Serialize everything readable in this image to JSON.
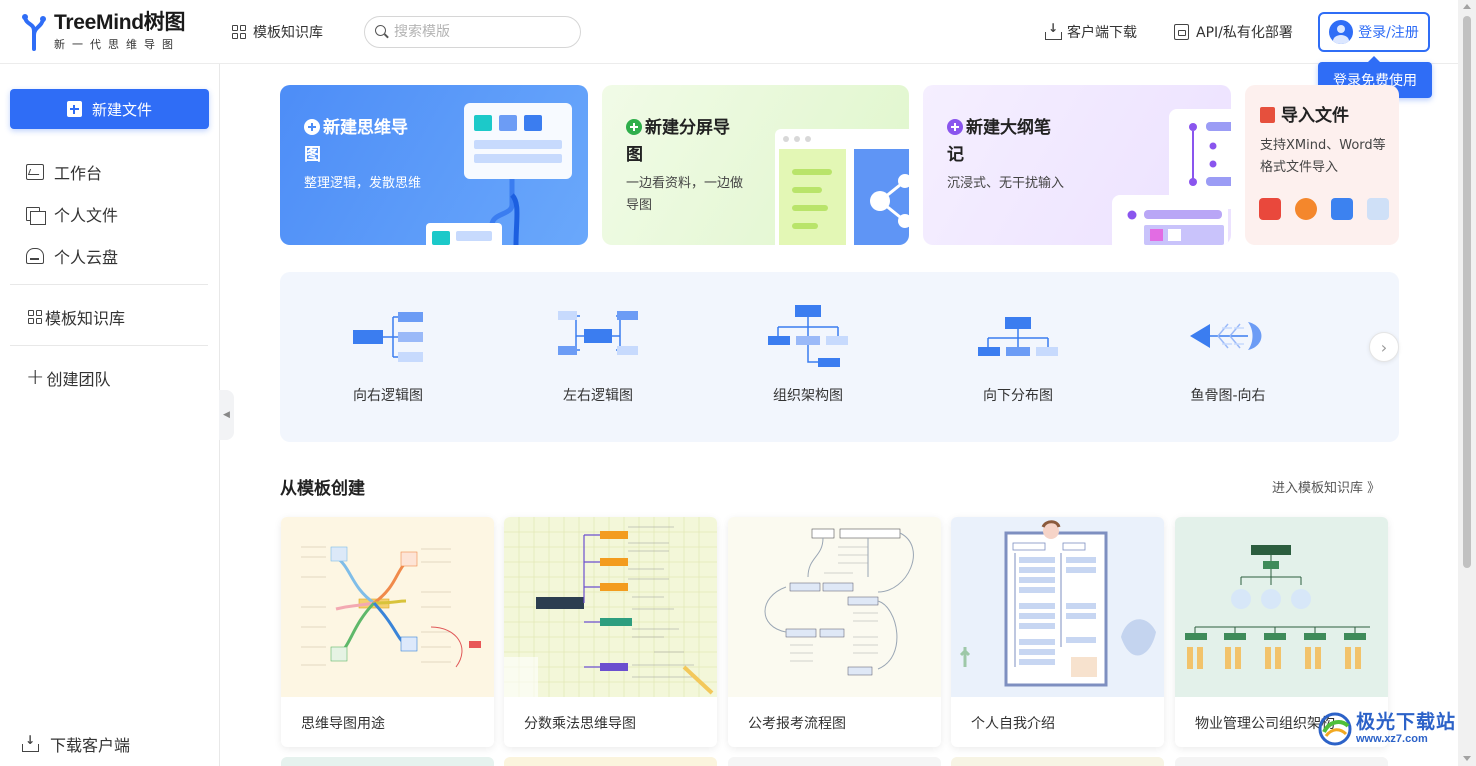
{
  "header": {
    "logo_title": "TreeMind树图",
    "logo_subtitle": "新一代思维导图",
    "nav_templates": "模板知识库",
    "search_placeholder": "搜索模版",
    "client_download": "客户端下载",
    "api_deploy": "API/私有化部署",
    "login": "登录/注册",
    "login_tooltip": "登录免费使用"
  },
  "sidebar": {
    "new_file": "新建文件",
    "items": [
      {
        "label": "工作台",
        "icon": "workbench-icon"
      },
      {
        "label": "个人文件",
        "icon": "folder-icon"
      },
      {
        "label": "个人云盘",
        "icon": "cloud-drive-icon"
      }
    ],
    "template_library": "模板知识库",
    "create_team": "创建团队",
    "download_client": "下载客户端"
  },
  "quick_cards": [
    {
      "title": "新建思维导图",
      "desc": "整理逻辑，发散思维",
      "accent": "#4d8df7"
    },
    {
      "title": "新建分屏导图",
      "desc": "一边看资料，一边做导图",
      "accent": "#2fae4b"
    },
    {
      "title": "新建大纲笔记",
      "desc": "沉浸式、无干扰输入",
      "accent": "#8a55ee"
    },
    {
      "title": "导入文件",
      "desc": "支持XMind、Word等格式文件导入",
      "accent": "#e6503d"
    }
  ],
  "structures": [
    {
      "label": "向右逻辑图",
      "icon": "right-logic-icon"
    },
    {
      "label": "左右逻辑图",
      "icon": "left-right-logic-icon"
    },
    {
      "label": "组织架构图",
      "icon": "org-chart-icon"
    },
    {
      "label": "向下分布图",
      "icon": "down-tree-icon"
    },
    {
      "label": "鱼骨图-向右",
      "icon": "fishbone-icon"
    }
  ],
  "templates_section": {
    "title": "从模板创建",
    "more": "进入模板知识库 》",
    "items": [
      {
        "label": "思维导图用途"
      },
      {
        "label": "分数乘法思维导图"
      },
      {
        "label": "公考报考流程图"
      },
      {
        "label": "个人自我介绍"
      },
      {
        "label": "物业管理公司组织架构"
      }
    ]
  },
  "watermark": {
    "text": "极光下载站",
    "url": "www.xz7.com"
  },
  "colors": {
    "primary": "#2f6df6",
    "panel_bg": "#f2f6fd"
  }
}
